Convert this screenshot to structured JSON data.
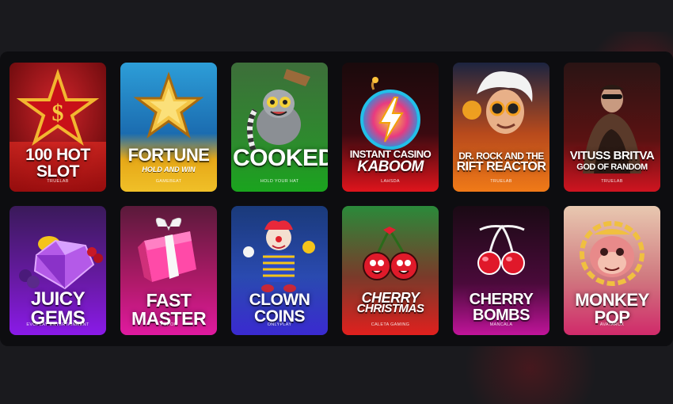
{
  "games": [
    {
      "title": "100 HOT SLOT",
      "subtitle": "",
      "provider": "TRUELAB",
      "icon": "red-star-dollar-icon"
    },
    {
      "title": "FORTUNE",
      "subtitle": "HOLD AND WIN",
      "provider": "GAMEBEAT",
      "icon": "gold-star-icon"
    },
    {
      "title": "COOKED",
      "subtitle": "",
      "provider": "HOLD YOUR HAT",
      "icon": "lemur-chef-icon"
    },
    {
      "title": "INSTANT CASINO",
      "subtitle": "KABOOM",
      "provider": "LAHSDA",
      "icon": "lightning-bomb-icon"
    },
    {
      "title": "DR. ROCK AND THE",
      "subtitle": "RIFT REACTOR",
      "provider": "TRUELAB",
      "icon": "scientist-icon"
    },
    {
      "title": "VITUSS BRITVA",
      "subtitle": "GOD OF RANDOM",
      "provider": "TRUELAB",
      "icon": "gangster-icon"
    },
    {
      "title": "JUICY GEMS",
      "subtitle": "",
      "provider": "EVOPLAY ENTERTAINMENT",
      "icon": "purple-gem-icon"
    },
    {
      "title": "FAST MASTER",
      "subtitle": "",
      "provider": "POPOK",
      "icon": "gift-box-icon"
    },
    {
      "title": "CLOWN COINS",
      "subtitle": "",
      "provider": "ONLYPLAY",
      "icon": "clown-icon"
    },
    {
      "title": "CHERRY",
      "subtitle": "CHRISTMAS",
      "provider": "CALETA GAMING",
      "icon": "cherry-characters-icon"
    },
    {
      "title": "CHERRY BOMBS",
      "subtitle": "",
      "provider": "MANCALA",
      "icon": "cherries-icon"
    },
    {
      "title": "MONKEY POP",
      "subtitle": "",
      "provider": "AVATARUX",
      "icon": "monkey-icon"
    }
  ]
}
